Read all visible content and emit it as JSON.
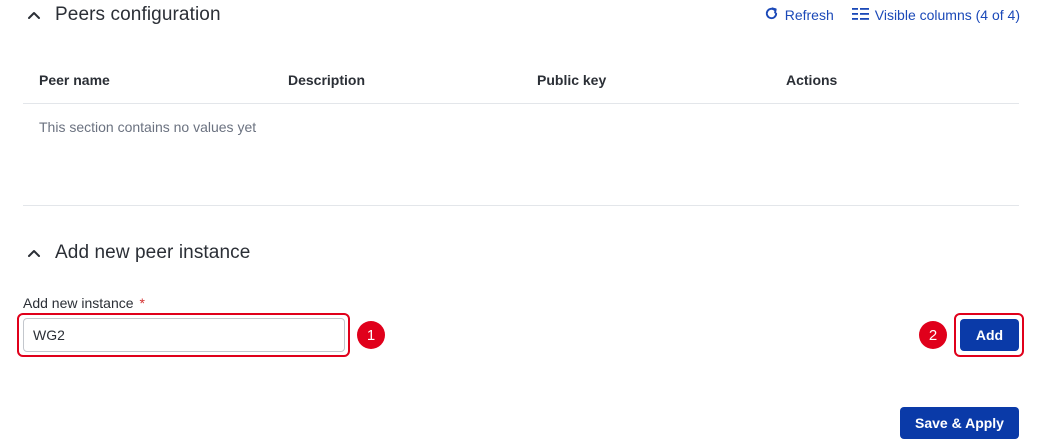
{
  "peers_section": {
    "title": "Peers configuration",
    "toolbar": {
      "refresh_label": "Refresh",
      "visible_columns_label": "Visible columns (4 of 4)"
    },
    "table": {
      "columns": [
        "Peer name",
        "Description",
        "Public key",
        "Actions"
      ],
      "empty_message": "This section contains no values yet"
    }
  },
  "add_section": {
    "title": "Add new peer instance",
    "field_label": "Add new instance",
    "required_mark": "*",
    "input_value": "WG2",
    "add_button_label": "Add"
  },
  "annotations": {
    "step1": "1",
    "step2": "2"
  },
  "footer": {
    "save_apply_label": "Save & Apply"
  },
  "colors": {
    "primary": "#0a3aa8",
    "link": "#1b49b8",
    "highlight": "#e0001b"
  }
}
